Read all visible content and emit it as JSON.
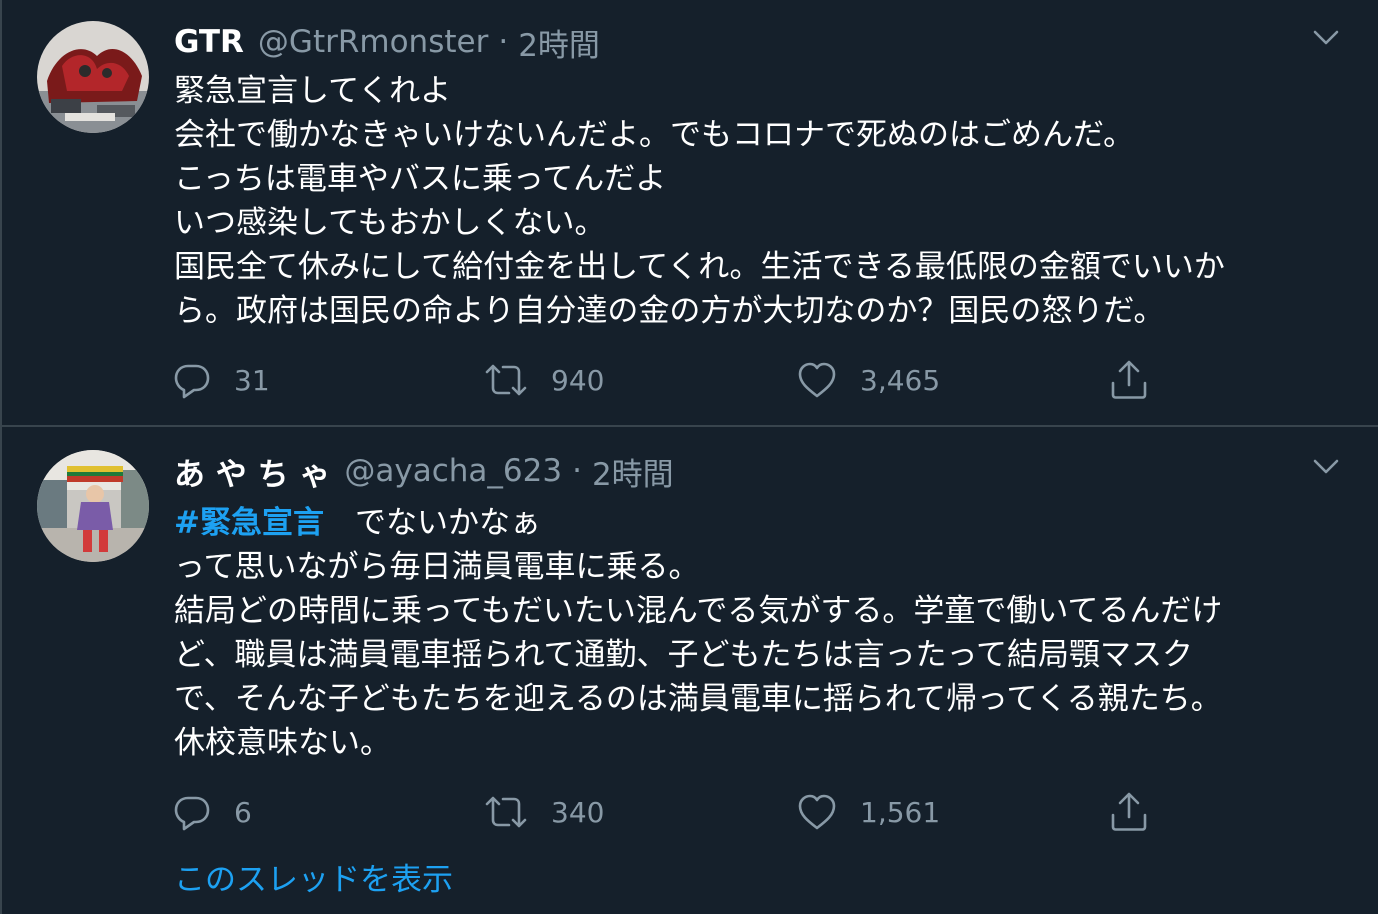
{
  "tweets": [
    {
      "display_name": "GTR",
      "handle": "@GtrRmonster",
      "separator": "·",
      "time": "2時間",
      "lines": [
        "緊急宣言してくれよ",
        "会社で働かなきゃいけないんだよ。でもコロナで死ぬのはごめんだ。",
        "こっちは電車やバスに乗ってんだよ",
        "いつ感染してもおかしくない。",
        "国民全て休みにして給付金を出してくれ。生活できる最低限の金額でいいか",
        "ら。政府は国民の命より自分達の金の方が大切なのか？国民の怒りだ。"
      ],
      "replies": "31",
      "retweets": "940",
      "likes": "3,465"
    },
    {
      "display_name": "あ や ち ゃ",
      "handle": "@ayacha_623",
      "separator": "·",
      "time": "2時間",
      "hashtag": "#緊急宣言",
      "first_line_rest": "　でないかなぁ",
      "lines": [
        "って思いながら毎日満員電車に乗る。",
        "結局どの時間に乗ってもだいたい混んでる気がする。学童で働いてるんだけ",
        "ど、職員は満員電車揺られて通勤、子どもたちは言ったって結局顎マスク",
        "で、そんな子どもたちを迎えるのは満員電車に揺られて帰ってくる親たち。",
        "休校意味ない。"
      ],
      "replies": "6",
      "retweets": "340",
      "likes": "1,561",
      "show_thread": "このスレッドを表示"
    }
  ],
  "icons": {
    "caret": "chevron-down-icon",
    "reply": "reply-icon",
    "retweet": "retweet-icon",
    "like": "heart-icon",
    "share": "share-icon"
  },
  "colors": {
    "background": "#15202b",
    "text": "#ffffff",
    "muted": "#8899a6",
    "accent": "#1da1f2",
    "divider": "#38444d"
  }
}
